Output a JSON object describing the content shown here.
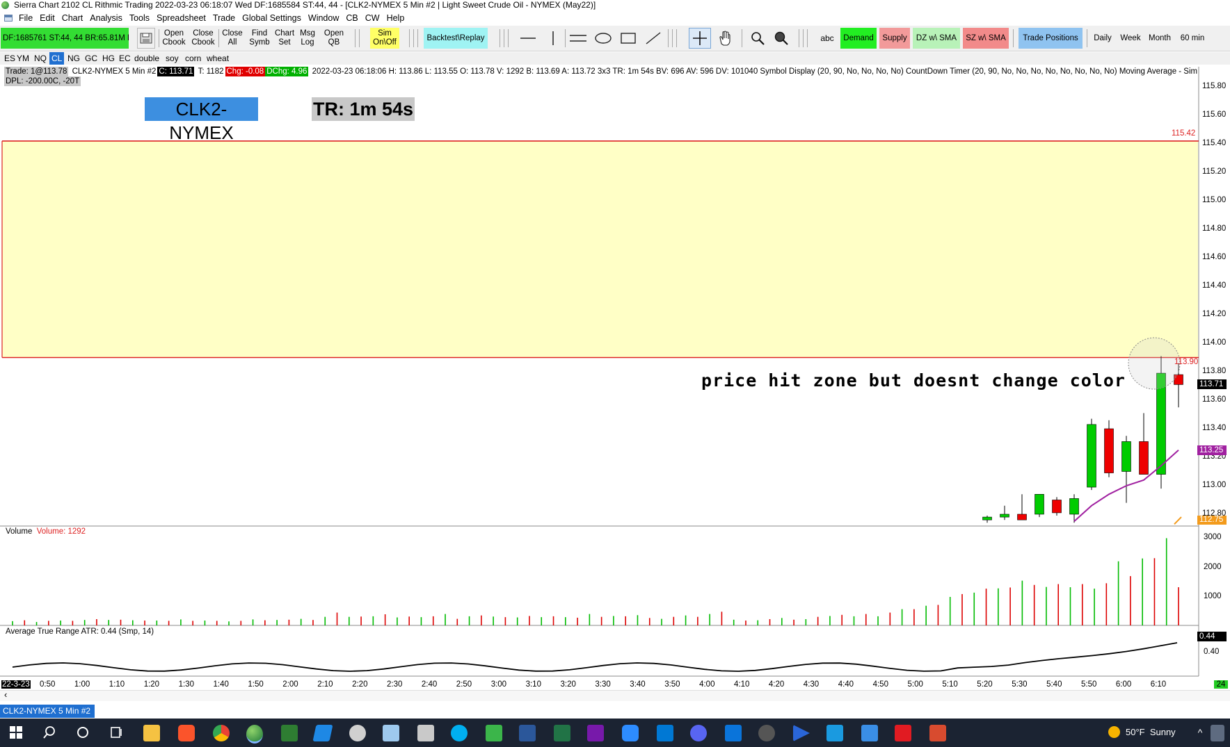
{
  "window": {
    "title": "Sierra Chart 2102 CL  Rithmic Trading 2022-03-23  06:18:07 Wed  DF:1685584  ST:44, 44 - [CLK2-NYMEX  5 Min  #2 | Light Sweet Crude Oil - NYMEX (May22)]"
  },
  "menu": [
    "File",
    "Edit",
    "Chart",
    "Analysis",
    "Tools",
    "Spreadsheet",
    "Trade",
    "Global Settings",
    "Window",
    "CB",
    "CW",
    "Help"
  ],
  "toolbar": {
    "status": "DF:1685761  ST:44, 44  BR:65.81M  D",
    "buttons": [
      {
        "line1": "Open",
        "line2": "Cbook"
      },
      {
        "line1": "Close",
        "line2": "Cbook"
      },
      {
        "line1": "Close",
        "line2": "All"
      },
      {
        "line1": "Find",
        "line2": "Symb"
      },
      {
        "line1": "Chart",
        "line2": "Set"
      },
      {
        "line1": "Msg",
        "line2": "Log"
      },
      {
        "line1": "Open",
        "line2": "QB"
      }
    ],
    "sim": {
      "line1": "Sim",
      "line2": "On\\Off"
    },
    "backtest": "Backtest\\Replay",
    "abc": "abc",
    "demand": "Demand",
    "supply": "Supply",
    "dz_sma": "DZ w\\ SMA",
    "sz_sma": "SZ w\\ SMA",
    "trade_positions": "Trade Positions",
    "daily": "Daily",
    "week": "Week",
    "month": "Month",
    "min60": "60 min",
    "colors": {
      "green_status": "#33dd33",
      "demand": "#22ee22",
      "supply": "#f29a9a",
      "dz": "#b8f2b8",
      "sz": "#f28a8a",
      "trade": "#8fc3f0",
      "backtest": "#9ff3f3",
      "sim": "#ffff66"
    }
  },
  "symbols": [
    {
      "label": "ES",
      "active": false
    },
    {
      "label": "YM",
      "active": false
    },
    {
      "label": "NQ",
      "active": false
    },
    {
      "label": "CL",
      "active": true
    },
    {
      "label": "NG",
      "active": false
    },
    {
      "label": "GC",
      "active": false
    },
    {
      "label": "HG",
      "active": false
    },
    {
      "label": "EC",
      "active": false
    },
    {
      "label": "double",
      "active": false
    },
    {
      "label": "soy",
      "active": false
    },
    {
      "label": "corn",
      "active": false
    },
    {
      "label": "wheat",
      "active": false
    }
  ],
  "chart": {
    "info": {
      "trade": "Trade: 1@113.78",
      "symbol": "CLK2-NYMEX  5 Min   #2",
      "close": "C: 113.71",
      "ticks": "T: 1182",
      "chg": "Chg: -0.08",
      "dchg": "DChg: 4.96",
      "details": "2022-03-23 06:18:06 H: 113.86 L: 113.55 O: 113.78 V: 1292 B: 113.69 A: 113.72 3x3 TR: 1m 54s BV: 696 AV: 596 DV: 101040 Symbol Display  (20, 90, No, No, No, No)  CountDown Timer  (20, 90, No, No, No, No, No, No, No, No)  Moving Average - Sim",
      "dpl": "DPL: -200.00C, -20T"
    },
    "symbol_label": "CLK2-NYMEX",
    "timer_label": "TR: 1m 54s",
    "annotation": "price hit zone but doesnt change color",
    "zone": {
      "top": 115.42,
      "bottom": 113.9,
      "top_label": "115.42",
      "bottom_label": "113.90",
      "fill": "#ffffc6",
      "border": "#dd2222"
    },
    "price_axis": [
      "115.80",
      "115.60",
      "115.40",
      "115.20",
      "115.00",
      "114.80",
      "114.60",
      "114.40",
      "114.20",
      "114.00",
      "113.80",
      "113.60",
      "113.40",
      "113.20",
      "113.00",
      "112.80"
    ],
    "last_price_tag": "113.71",
    "ma_tag": "113.25",
    "low_tag": "112.75",
    "volume_label": "Volume",
    "volume_value": "Volume: 1292",
    "volume_axis": [
      "3000",
      "2000",
      "1000"
    ],
    "atr_label": "Average True Range  ATR: 0.44   (Smp, 14)",
    "atr_tag": "0.44",
    "atr_axis": [
      "0.40"
    ],
    "date_label": "22-3-23",
    "time_axis": [
      "0:50",
      "1:00",
      "1:10",
      "1:20",
      "1:30",
      "1:40",
      "1:50",
      "2:00",
      "2:10",
      "2:20",
      "2:30",
      "2:40",
      "2:50",
      "3:00",
      "3:10",
      "3:20",
      "3:30",
      "3:40",
      "3:50",
      "4:00",
      "4:10",
      "4:20",
      "4:30",
      "4:40",
      "4:50",
      "5:00",
      "5:10",
      "5:20",
      "5:30",
      "5:40",
      "5:50",
      "6:00",
      "6:10"
    ],
    "corner_tag": "24",
    "tab_label": "CLK2-NYMEX  5 Min   #2"
  },
  "chart_data": {
    "type": "candlestick",
    "candles": [
      {
        "time": "5:25",
        "o": 112.76,
        "h": 112.79,
        "l": 112.74,
        "c": 112.78
      },
      {
        "time": "5:30",
        "o": 112.78,
        "h": 112.86,
        "l": 112.76,
        "c": 112.8
      },
      {
        "time": "5:35",
        "o": 112.8,
        "h": 112.94,
        "l": 112.77,
        "c": 112.76
      },
      {
        "time": "5:40",
        "o": 112.8,
        "h": 112.93,
        "l": 112.78,
        "c": 112.94
      },
      {
        "time": "5:45",
        "o": 112.9,
        "h": 112.92,
        "l": 112.79,
        "c": 112.81
      },
      {
        "time": "5:50",
        "o": 112.8,
        "h": 112.94,
        "l": 112.74,
        "c": 112.91
      },
      {
        "time": "5:55",
        "o": 112.99,
        "h": 113.47,
        "l": 112.97,
        "c": 113.43
      },
      {
        "time": "6:00",
        "o": 113.4,
        "h": 113.46,
        "l": 113.06,
        "c": 113.09
      },
      {
        "time": "6:05",
        "o": 113.1,
        "h": 113.35,
        "l": 112.88,
        "c": 113.31
      },
      {
        "time": "6:10",
        "o": 113.31,
        "h": 113.51,
        "l": 113.09,
        "c": 113.08
      },
      {
        "time": "6:15",
        "o": 113.08,
        "h": 113.91,
        "l": 112.98,
        "c": 113.79
      },
      {
        "time": "6:18",
        "o": 113.78,
        "h": 113.86,
        "l": 113.55,
        "c": 113.71
      }
    ],
    "moving_average": [
      {
        "time": "5:50",
        "v": 112.75
      },
      {
        "time": "5:55",
        "v": 112.86
      },
      {
        "time": "6:00",
        "v": 112.94
      },
      {
        "time": "6:05",
        "v": 113.0
      },
      {
        "time": "6:10",
        "v": 113.04
      },
      {
        "time": "6:15",
        "v": 113.14
      },
      {
        "time": "6:18",
        "v": 113.25
      }
    ],
    "volume": [
      150,
      180,
      120,
      160,
      170,
      160,
      190,
      220,
      190,
      200,
      180,
      170,
      170,
      160,
      210,
      160,
      170,
      160,
      140,
      160,
      210,
      180,
      190,
      200,
      230,
      190,
      300,
      450,
      300,
      310,
      320,
      390,
      280,
      310,
      290,
      320,
      400,
      230,
      320,
      350,
      310,
      290,
      280,
      330,
      290,
      320,
      290,
      270,
      400,
      300,
      330,
      320,
      360,
      260,
      230,
      300,
      350,
      300,
      400,
      480,
      200,
      170,
      180,
      220,
      260,
      200,
      220,
      300,
      330,
      370,
      320,
      400,
      320,
      450,
      570,
      570,
      690,
      720,
      1000,
      1100,
      1150,
      1290,
      1300,
      1330,
      1570,
      1420,
      1350,
      1450,
      1340,
      1450,
      1290,
      1480,
      2250,
      1730,
      2350,
      2360,
      3060,
      1340
    ],
    "volume_colors": "alternating green/red per bar",
    "atr_range": [
      0.34,
      0.48
    ],
    "yaxis_range": [
      112.8,
      115.85
    ]
  }
}
